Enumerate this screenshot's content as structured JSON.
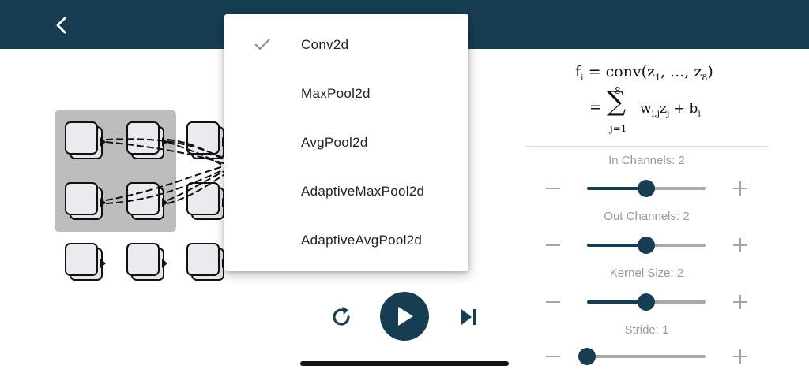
{
  "header": {
    "back_icon": "chevron-left-icon",
    "color": "#173d52"
  },
  "layer_menu": {
    "selected": "Conv2d",
    "items": [
      {
        "label": "Conv2d",
        "checked": true
      },
      {
        "label": "MaxPool2d",
        "checked": false
      },
      {
        "label": "AvgPool2d",
        "checked": false
      },
      {
        "label": "AdaptiveMaxPool2d",
        "checked": false
      },
      {
        "label": "AdaptiveAvgPool2d",
        "checked": false
      }
    ]
  },
  "formula": {
    "line1": "fᵢ = conv(z₁, ..., z₈)",
    "line1_lhs": "f",
    "line1_lhs_sub": "i",
    "line1_rhs": "= conv(z",
    "line1_z1_sub": "1",
    "line1_mid": ", ..., z",
    "line1_z8_sub": "8",
    "line1_end": ")",
    "eq": "=",
    "sigma": "∑",
    "sum_upper": "8",
    "sum_lower": "j=1",
    "term_w": "w",
    "term_w_sub": "i,j",
    "term_z": "z",
    "term_z_sub": "j",
    "term_plus": " + b",
    "term_b_sub": "i"
  },
  "params": [
    {
      "label": "In Channels: 2",
      "fraction": 0.5
    },
    {
      "label": "Out Channels: 2",
      "fraction": 0.5
    },
    {
      "label": "Kernel Size: 2",
      "fraction": 0.5
    },
    {
      "label": "Stride: 1",
      "fraction": 0.0
    }
  ],
  "playback": {
    "replay_icon": "replay-icon",
    "play_icon": "play-icon",
    "skip_icon": "skip-next-icon"
  },
  "colors": {
    "accent": "#173d52",
    "selection": "#bdbdbd",
    "node_fill": "#e9ebee",
    "muted": "#9a9a9a"
  }
}
